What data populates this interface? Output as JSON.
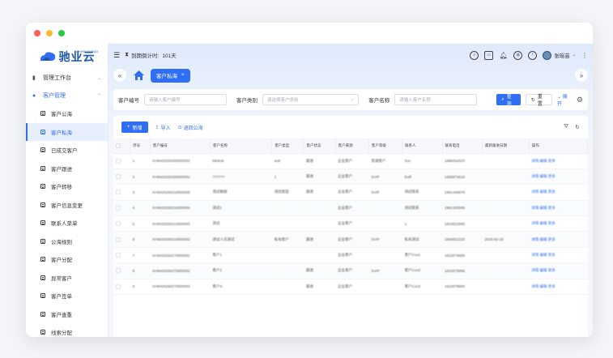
{
  "logo": {
    "text": "驰业云",
    "sub": "CHIYE CLOUD"
  },
  "sidebar": {
    "groups": [
      {
        "label": "管理工作台",
        "icon": "chart-icon"
      },
      {
        "label": "客户管理",
        "icon": "user-icon"
      }
    ],
    "items": [
      {
        "label": "客户公海"
      },
      {
        "label": "客户私海"
      },
      {
        "label": "已成交客户"
      },
      {
        "label": "客户跟进"
      },
      {
        "label": "客户转移"
      },
      {
        "label": "客户信息变更"
      },
      {
        "label": "联系人菜单"
      },
      {
        "label": "公海规则"
      },
      {
        "label": "客户分配"
      },
      {
        "label": "异常客户"
      },
      {
        "label": "客户签单"
      },
      {
        "label": "客户查重"
      },
      {
        "label": "线索分配"
      }
    ]
  },
  "topbar": {
    "countdown_label": "到期倒计时:",
    "countdown_value": "101天",
    "user_name": "张瑶芸"
  },
  "tabs": {
    "active": "客户私海"
  },
  "filter": {
    "code_label": "客户编号",
    "code_placeholder": "请输入客户编号",
    "type_label": "客户类别",
    "type_placeholder": "请选择客户类别",
    "name_label": "客户名称",
    "name_placeholder": "请输入客户名称",
    "query": "查询",
    "reset": "重置",
    "expand": "展开"
  },
  "toolbar": {
    "add": "新增",
    "import": "导入",
    "return": "退回公海"
  },
  "table": {
    "headers": [
      "",
      "序号",
      "客户编号",
      "客户名称",
      "客户类型",
      "客户状态",
      "客户来源",
      "客户等级",
      "联系人",
      "联系电话",
      "最新跟进日期",
      "操作"
    ],
    "rows": [
      [
        "",
        "1",
        "KH8420250200000002",
        "blinkok",
        "aoit",
        "跟进",
        "企业客户",
        "普通客户",
        "Soc",
        "1998264533",
        "",
        "详情 编辑 更多"
      ],
      [
        "",
        "2",
        "KH8420250200000001",
        "??????",
        "1",
        "跟进",
        "企业客户",
        "SVIP",
        "Evill",
        "1568874610",
        "",
        "详情 编辑 更多"
      ],
      [
        "",
        "3",
        "KH8420250210000005",
        "测试数据",
        "测试类型",
        "跟进",
        "企业客户",
        "SVIP",
        "测试联系",
        "1991449679",
        "",
        "详情 编辑 更多"
      ],
      [
        "",
        "4",
        "KH8420250210000004",
        "测试1",
        "",
        "",
        "企业客户",
        "",
        "测试联系",
        "1991320568",
        "",
        "详情 编辑 更多"
      ],
      [
        "",
        "5",
        "KH8420250210000003",
        "测试",
        "",
        "",
        "企业客户",
        "",
        "1",
        "1823022695",
        "",
        "详情 编辑 更多"
      ],
      [
        "",
        "6",
        "KH8420250210000002",
        "测试人员测试",
        "私有客户",
        "跟进",
        "企业客户",
        "SVIP",
        "私有测试",
        "1994822225",
        "2025-02-18",
        "详情 编辑 更多"
      ],
      [
        "",
        "7",
        "KH8420250270000001",
        "客户1",
        "",
        "",
        "企业客户",
        "",
        "客户Cus1",
        "1623079906",
        "",
        "详情 编辑 更多"
      ],
      [
        "",
        "8",
        "KH8420250270000002",
        "客户2",
        "",
        "跟进",
        "企业客户",
        "SVIP",
        "客户Cus2",
        "1623079906",
        "",
        "详情 编辑 更多"
      ],
      [
        "",
        "9",
        "KH8420250270000003",
        "客户3",
        "",
        "跟进",
        "企业客户",
        "",
        "客户Cus3",
        "1623079906",
        "",
        "详情 编辑 更多"
      ]
    ]
  },
  "colors": {
    "accent": "#2f6ef5",
    "mac_red": "#ff5f57",
    "mac_yellow": "#febc2e",
    "mac_green": "#28c840"
  }
}
